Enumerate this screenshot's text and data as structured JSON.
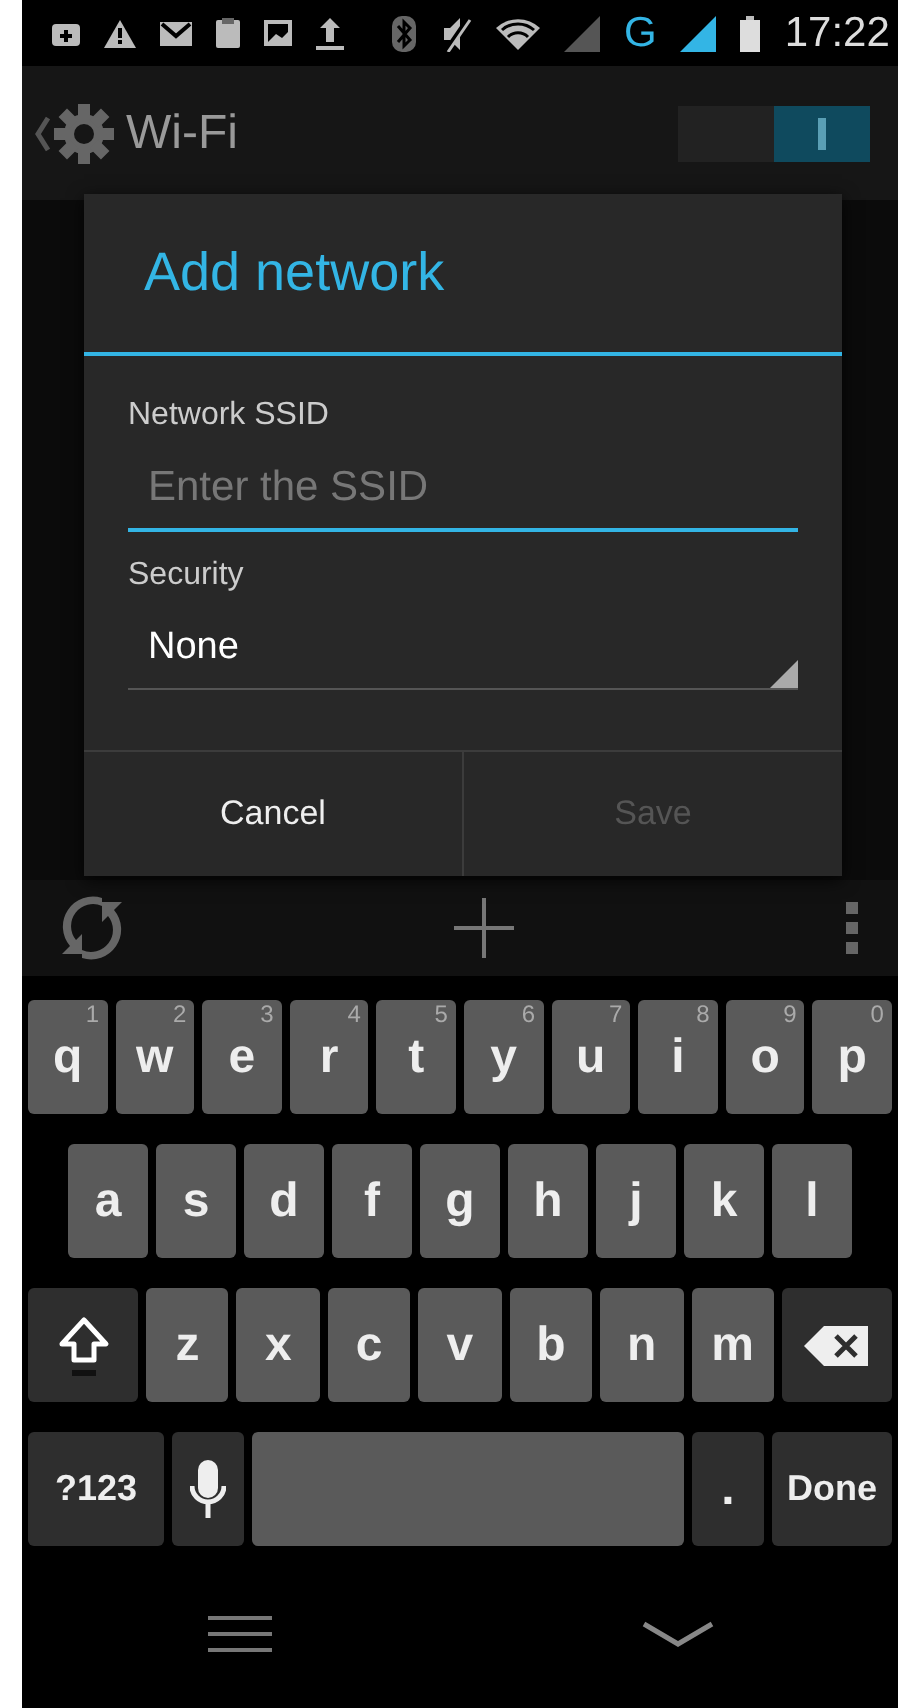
{
  "status_bar": {
    "network": "G",
    "time": "17:22"
  },
  "action_bar": {
    "title": "Wi-Fi",
    "switch": {
      "on": true
    }
  },
  "dialog": {
    "title": "Add network",
    "fields": [
      {
        "kind": "text",
        "label": "Network SSID",
        "placeholder": "Enter the SSID"
      },
      {
        "kind": "select",
        "label": "Security",
        "value": "None"
      }
    ],
    "buttons": [
      {
        "label": "Cancel",
        "disabled": false
      },
      {
        "label": "Save",
        "disabled": true
      }
    ]
  },
  "keyboard": {
    "rows": [
      {
        "keys": [
          {
            "kind": "letter",
            "label": "q",
            "hint": "1"
          },
          {
            "kind": "letter",
            "label": "w",
            "hint": "2"
          },
          {
            "kind": "letter",
            "label": "e",
            "hint": "3"
          },
          {
            "kind": "letter",
            "label": "r",
            "hint": "4"
          },
          {
            "kind": "letter",
            "label": "t",
            "hint": "5"
          },
          {
            "kind": "letter",
            "label": "y",
            "hint": "6"
          },
          {
            "kind": "letter",
            "label": "u",
            "hint": "7"
          },
          {
            "kind": "letter",
            "label": "i",
            "hint": "8"
          },
          {
            "kind": "letter",
            "label": "o",
            "hint": "9"
          },
          {
            "kind": "letter",
            "label": "p",
            "hint": "0"
          }
        ]
      },
      {
        "keys": [
          {
            "kind": "letter",
            "label": "a"
          },
          {
            "kind": "letter",
            "label": "s"
          },
          {
            "kind": "letter",
            "label": "d"
          },
          {
            "kind": "letter",
            "label": "f"
          },
          {
            "kind": "letter",
            "label": "g"
          },
          {
            "kind": "letter",
            "label": "h"
          },
          {
            "kind": "letter",
            "label": "j"
          },
          {
            "kind": "letter",
            "label": "k"
          },
          {
            "kind": "letter",
            "label": "l"
          }
        ]
      },
      {
        "keys": [
          {
            "kind": "shift"
          },
          {
            "kind": "letter",
            "label": "z"
          },
          {
            "kind": "letter",
            "label": "x"
          },
          {
            "kind": "letter",
            "label": "c"
          },
          {
            "kind": "letter",
            "label": "v"
          },
          {
            "kind": "letter",
            "label": "b"
          },
          {
            "kind": "letter",
            "label": "n"
          },
          {
            "kind": "letter",
            "label": "m"
          },
          {
            "kind": "backspace"
          }
        ]
      },
      {
        "keys": [
          {
            "kind": "symbols",
            "label": "?123"
          },
          {
            "kind": "mic"
          },
          {
            "kind": "space"
          },
          {
            "kind": "period",
            "label": "."
          },
          {
            "kind": "done",
            "label": "Done"
          }
        ]
      }
    ]
  }
}
